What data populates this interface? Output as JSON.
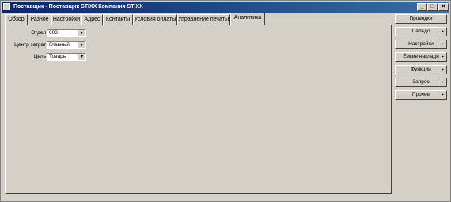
{
  "window": {
    "title": "Поставщик - Поставщик STIXX Компания STIXX",
    "minimize_glyph": "_",
    "maximize_glyph": "□",
    "close_glyph": "✕"
  },
  "tabs": [
    {
      "label": "Обзор"
    },
    {
      "label": "Разное"
    },
    {
      "label": "Настройки"
    },
    {
      "label": "Адрес"
    },
    {
      "label": "Контакты"
    },
    {
      "label": "Условия оплаты"
    },
    {
      "label": "Управление печатью"
    },
    {
      "label": "Аналитика",
      "active": true
    }
  ],
  "fields": [
    {
      "label": "Отдел",
      "value": "003",
      "button_glyph": "▾"
    },
    {
      "label": "Центр затрат",
      "value": "Главный",
      "button_glyph": "▾"
    },
    {
      "label": "Цель",
      "value": "Товары",
      "button_glyph": "▾"
    }
  ],
  "sidebar": {
    "buttons": [
      {
        "label": "Проводки",
        "arrow": ""
      },
      {
        "label": "Сальдо",
        "arrow": "▸"
      },
      {
        "label": "Настройки",
        "arrow": "▸"
      },
      {
        "label": "Ёмкие накладн",
        "arrow": "▸"
      },
      {
        "label": "Функции",
        "arrow": "▸"
      },
      {
        "label": "Запрос",
        "arrow": "▸"
      },
      {
        "label": "Прочее",
        "arrow": "▸"
      }
    ]
  }
}
